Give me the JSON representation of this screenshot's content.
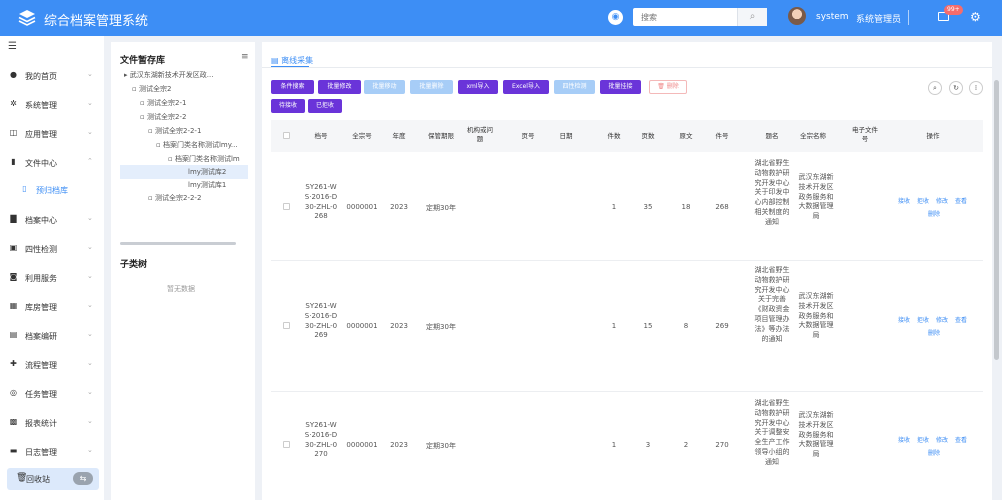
{
  "header": {
    "title": "综合档案管理系统",
    "search_placeholder": "搜索",
    "user_name": "system",
    "user_role": "系统管理员",
    "mail_count": "99+"
  },
  "sidebar": {
    "items": [
      {
        "label": "我的首页",
        "icon": "user-icon"
      },
      {
        "label": "系统管理",
        "icon": "gear-icon"
      },
      {
        "label": "应用管理",
        "icon": "app-icon"
      },
      {
        "label": "文件中心",
        "icon": "file-icon"
      },
      {
        "label": "预归档库",
        "icon": "archive-icon"
      },
      {
        "label": "档案中心",
        "icon": "folder-icon"
      },
      {
        "label": "四性检测",
        "icon": "check-icon"
      },
      {
        "label": "利用服务",
        "icon": "service-icon"
      },
      {
        "label": "库房管理",
        "icon": "warehouse-icon"
      },
      {
        "label": "档案编研",
        "icon": "book-icon"
      },
      {
        "label": "流程管理",
        "icon": "flow-icon"
      },
      {
        "label": "任务管理",
        "icon": "task-icon"
      },
      {
        "label": "报表统计",
        "icon": "chart-icon"
      },
      {
        "label": "日志管理",
        "icon": "log-icon"
      }
    ],
    "recycle_label": "回收站"
  },
  "tree": {
    "title": "文件暂存库",
    "nodes": [
      "武汉东湖新技术开发区政...",
      "测试全宗2",
      "测试全宗2-1",
      "测试全宗2-2",
      "测试全宗2-2-1",
      "档案门类名称测试lmy...",
      "档案门类名称测试lm",
      "lmy测试库2",
      "lmy测试库1",
      "测试全宗2-2-2"
    ],
    "sub_title": "子类树",
    "no_data": "暂无数据"
  },
  "main": {
    "tab": "离线采集",
    "buttons": [
      "条件搜索",
      "批量修改",
      "批量移动",
      "批量删除",
      "xml导入",
      "Excel导入",
      "四性检测",
      "批量挂接",
      "删除",
      "待接收",
      "已拒收"
    ],
    "columns": [
      "档号",
      "全宗号",
      "年度",
      "保管期限",
      "机构或问题",
      "页号",
      "日期",
      "件数",
      "页数",
      "原文",
      "件号",
      "题名",
      "全宗名称",
      "电子文件号",
      "操作"
    ],
    "rows": [
      {
        "archive_no": "SY261-WS·2016-D30-ZHL-0268",
        "fonds_no": "0000001",
        "year": "2023",
        "retention": "定期30年",
        "count": "1",
        "pages": "35",
        "original": "18",
        "item_no": "268",
        "title": "湖北省野生动物救护研究开发中心关于印发中心内部控制相关制度的通知",
        "fonds_name": "武汉东湖新技术开发区政务服务和大数据管理局"
      },
      {
        "archive_no": "SY261-WS·2016-D30-ZHL-0269",
        "fonds_no": "0000001",
        "year": "2023",
        "retention": "定期30年",
        "count": "1",
        "pages": "15",
        "original": "8",
        "item_no": "269",
        "title": "湖北省野生动物救护研究开发中心关于完善《财政资金项目管理办法》等办法的通知",
        "fonds_name": "武汉东湖新技术开发区政务服务和大数据管理局"
      },
      {
        "archive_no": "SY261-WS·2016-D30-ZHL-0270",
        "fonds_no": "0000001",
        "year": "2023",
        "retention": "定期30年",
        "count": "1",
        "pages": "3",
        "original": "2",
        "item_no": "270",
        "title": "湖北省野生动物救护研究开发中心关于调整安全生产工作领导小组的通知",
        "fonds_name": "武汉东湖新技术开发区政务服务和大数据管理局"
      }
    ],
    "actions": [
      "接收",
      "拒收",
      "修改",
      "查看",
      "删除"
    ]
  }
}
